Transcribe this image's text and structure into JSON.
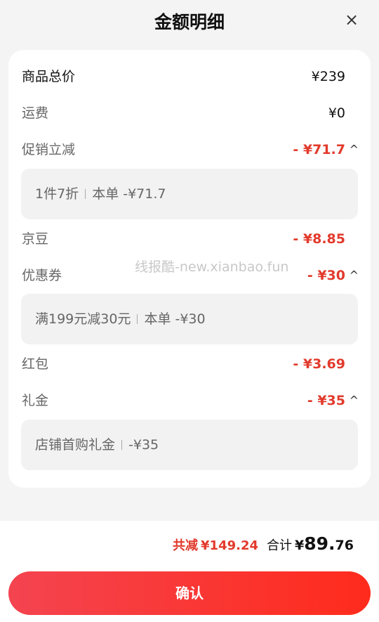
{
  "header": {
    "title": "金额明细",
    "close_glyph": "×"
  },
  "rows": {
    "product_total": {
      "label": "商品总价",
      "value": "¥239"
    },
    "shipping": {
      "label": "运费",
      "value": "¥0"
    },
    "promo": {
      "label": "促销立减",
      "value": "- ¥71.7",
      "chevron": "^"
    },
    "promo_detail": {
      "left": "1件7折",
      "right": "本单 -¥71.7"
    },
    "jingdou": {
      "label": "京豆",
      "value": "- ¥8.85"
    },
    "coupon": {
      "label": "优惠券",
      "value": "- ¥30",
      "chevron": "^"
    },
    "coupon_detail": {
      "left": "满199元减30元",
      "right": "本单 -¥30"
    },
    "red_packet": {
      "label": "红包",
      "value": "- ¥3.69"
    },
    "gift": {
      "label": "礼金",
      "value": "- ¥35",
      "chevron": "^"
    },
    "gift_detail": {
      "left": "店铺首购礼金",
      "right": "-¥35"
    }
  },
  "watermark": "线报酷-new.xianbao.fun",
  "summary": {
    "reduce_label": "共减",
    "reduce_amount": "¥149.24",
    "total_label": "合计",
    "currency": "¥",
    "total_int": "89.",
    "total_dec": "76"
  },
  "footer": {
    "confirm_label": "确认"
  },
  "colors": {
    "accent": "#e23a2c",
    "button_start": "#f44450",
    "button_end": "#ff2b1c"
  },
  "icons": {
    "close": "close-icon",
    "chevron": "chevron-up-icon"
  }
}
